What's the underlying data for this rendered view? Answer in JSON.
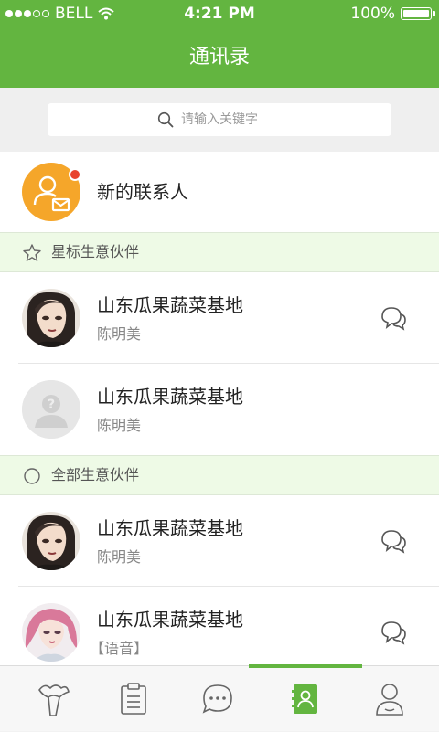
{
  "status_bar": {
    "carrier": "BELL",
    "time": "4:21 PM",
    "battery": "100%"
  },
  "header": {
    "title": "通讯录"
  },
  "search": {
    "placeholder": "请输入关键字"
  },
  "new_contact": {
    "label": "新的联系人"
  },
  "sections": [
    {
      "label": "星标生意伙伴",
      "icon": "star-icon"
    },
    {
      "label": "全部生意伙伴",
      "icon": "circle-icon"
    }
  ],
  "starred_contacts": [
    {
      "company": "山东瓜果蔬菜基地",
      "person": "陈明美",
      "avatar": "avatar-woman-dark-hair",
      "has_chat": true
    },
    {
      "company": "山东瓜果蔬菜基地",
      "person": "陈明美",
      "avatar": "avatar-placeholder",
      "has_chat": false
    }
  ],
  "all_contacts": [
    {
      "company": "山东瓜果蔬菜基地",
      "person": "陈明美",
      "avatar": "avatar-woman-dark-hair",
      "has_chat": true
    },
    {
      "company": "山东瓜果蔬菜基地",
      "person": "【语音】",
      "avatar": "avatar-woman-pink-hair",
      "has_chat": true
    }
  ],
  "tabbar": {
    "active_index": 3,
    "tabs": [
      "vegetable-icon",
      "clipboard-icon",
      "message-icon",
      "contacts-icon",
      "profile-icon"
    ]
  },
  "colors": {
    "accent": "#63b540",
    "section_bg": "#eefae6",
    "new_contact": "#f5a62a",
    "badge": "#e8432d"
  }
}
